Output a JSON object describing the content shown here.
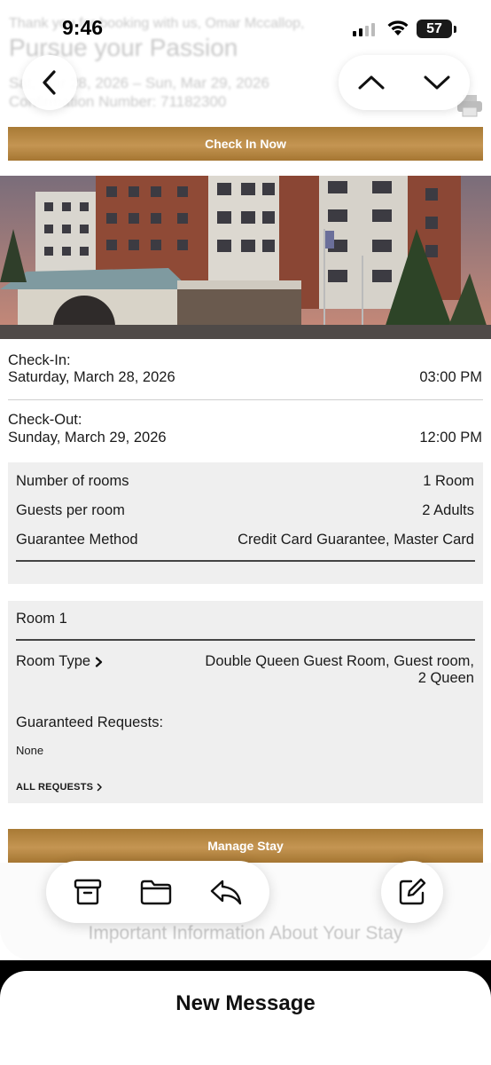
{
  "status_bar": {
    "time": "9:46",
    "battery": "57"
  },
  "email_header": {
    "thanks_text": "Thank you for booking with us, Omar Mccallop,",
    "title": "Pursue your Passion",
    "dates": "Sat, Mar 28, 2026 – Sun, Mar 29, 2026",
    "confirmation": "Confirmation Number: 71182300"
  },
  "buttons": {
    "check_in": "Check In Now",
    "manage_stay": "Manage Stay"
  },
  "stay": {
    "checkin_label": "Check-In:",
    "checkin_date": "Saturday, March 28, 2026",
    "checkin_time": "03:00 PM",
    "checkout_label": "Check-Out:",
    "checkout_date": "Sunday, March 29, 2026",
    "checkout_time": "12:00 PM"
  },
  "summary": {
    "rooms_label": "Number of rooms",
    "rooms_value": "1 Room",
    "guests_label": "Guests per room",
    "guests_value": "2 Adults",
    "guarantee_label": "Guarantee Method",
    "guarantee_value": "Credit Card Guarantee, Master Card"
  },
  "room": {
    "title": "Room 1",
    "type_label": "Room Type",
    "type_value_line1": "Double Queen Guest Room, Guest room,",
    "type_value_line2": "2 Queen",
    "requests_label": "Guaranteed Requests:",
    "requests_value": "None",
    "all_requests": "ALL REQUESTS"
  },
  "footer": {
    "faded_heading": "Important Information About Your Stay"
  },
  "compose_sheet": {
    "title": "New Message"
  },
  "colors": {
    "gold": "#b4843e",
    "panel_grey": "#efefef"
  }
}
